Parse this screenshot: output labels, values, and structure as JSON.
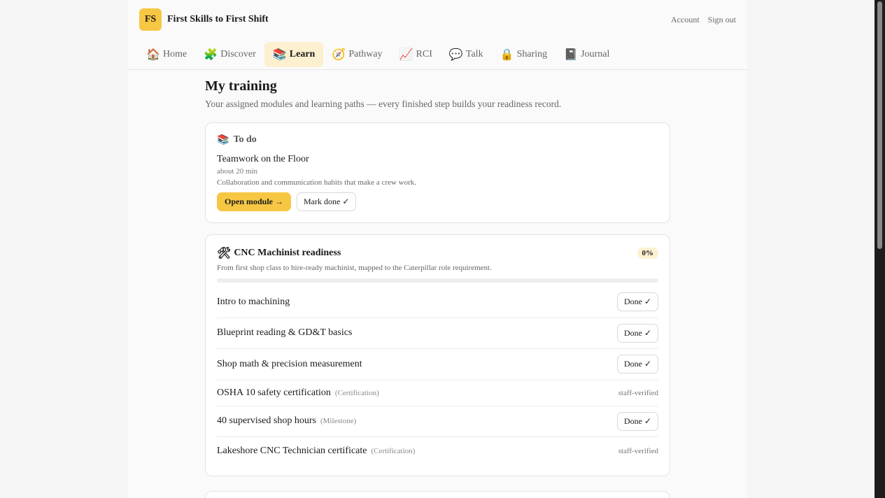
{
  "brand": {
    "initials": "FS",
    "name": "First Skills to First Shift"
  },
  "account": {
    "account_label": "Account",
    "signout_label": "Sign out"
  },
  "nav": [
    {
      "icon": "🏠",
      "label": "Home"
    },
    {
      "icon": "🧩",
      "label": "Discover"
    },
    {
      "icon": "📚",
      "label": "Learn"
    },
    {
      "icon": "🧭",
      "label": "Pathway"
    },
    {
      "icon": "📈",
      "label": "RCI"
    },
    {
      "icon": "💬",
      "label": "Talk"
    },
    {
      "icon": "🔒",
      "label": "Sharing"
    },
    {
      "icon": "📓",
      "label": "Journal"
    }
  ],
  "page": {
    "title": "My training",
    "subtitle": "Your assigned modules and learning paths — every finished step builds your readiness record."
  },
  "todo": {
    "icon": "📚",
    "heading": "To do",
    "module_title": "Teamwork on the Floor",
    "duration": "about 20 min",
    "description": "Collaboration and communication habits that make a crew work.",
    "open_label": "Open module →",
    "mark_done_label": "Mark done",
    "check": "✓"
  },
  "path": {
    "icon": "🛠",
    "title": "CNC Machinist readiness",
    "progress_label": "0%",
    "progress_value": 0,
    "description": "From first shop class to hire-ready machinist, mapped to the Caterpillar role requirement.",
    "steps": [
      {
        "label": "Intro to machining",
        "type": "",
        "status": "Done",
        "check": "✓"
      },
      {
        "label": "Blueprint reading & GD&T basics",
        "type": "",
        "status": "Done",
        "check": "✓"
      },
      {
        "label": "Shop math & precision measurement",
        "type": "",
        "status": "Done",
        "check": "✓"
      },
      {
        "label": "OSHA 10 safety certification",
        "type": "(Certification)",
        "status": "staff-verified",
        "check": ""
      },
      {
        "label": "40 supervised shop hours",
        "type": "(Milestone)",
        "status": "Done",
        "check": "✓"
      },
      {
        "label": "Lakeshore CNC Technician certificate",
        "type": "(Certification)",
        "status": "staff-verified",
        "check": ""
      }
    ]
  },
  "colors": {
    "accent": "#f7c744",
    "accent_soft": "#fdf0cf"
  }
}
